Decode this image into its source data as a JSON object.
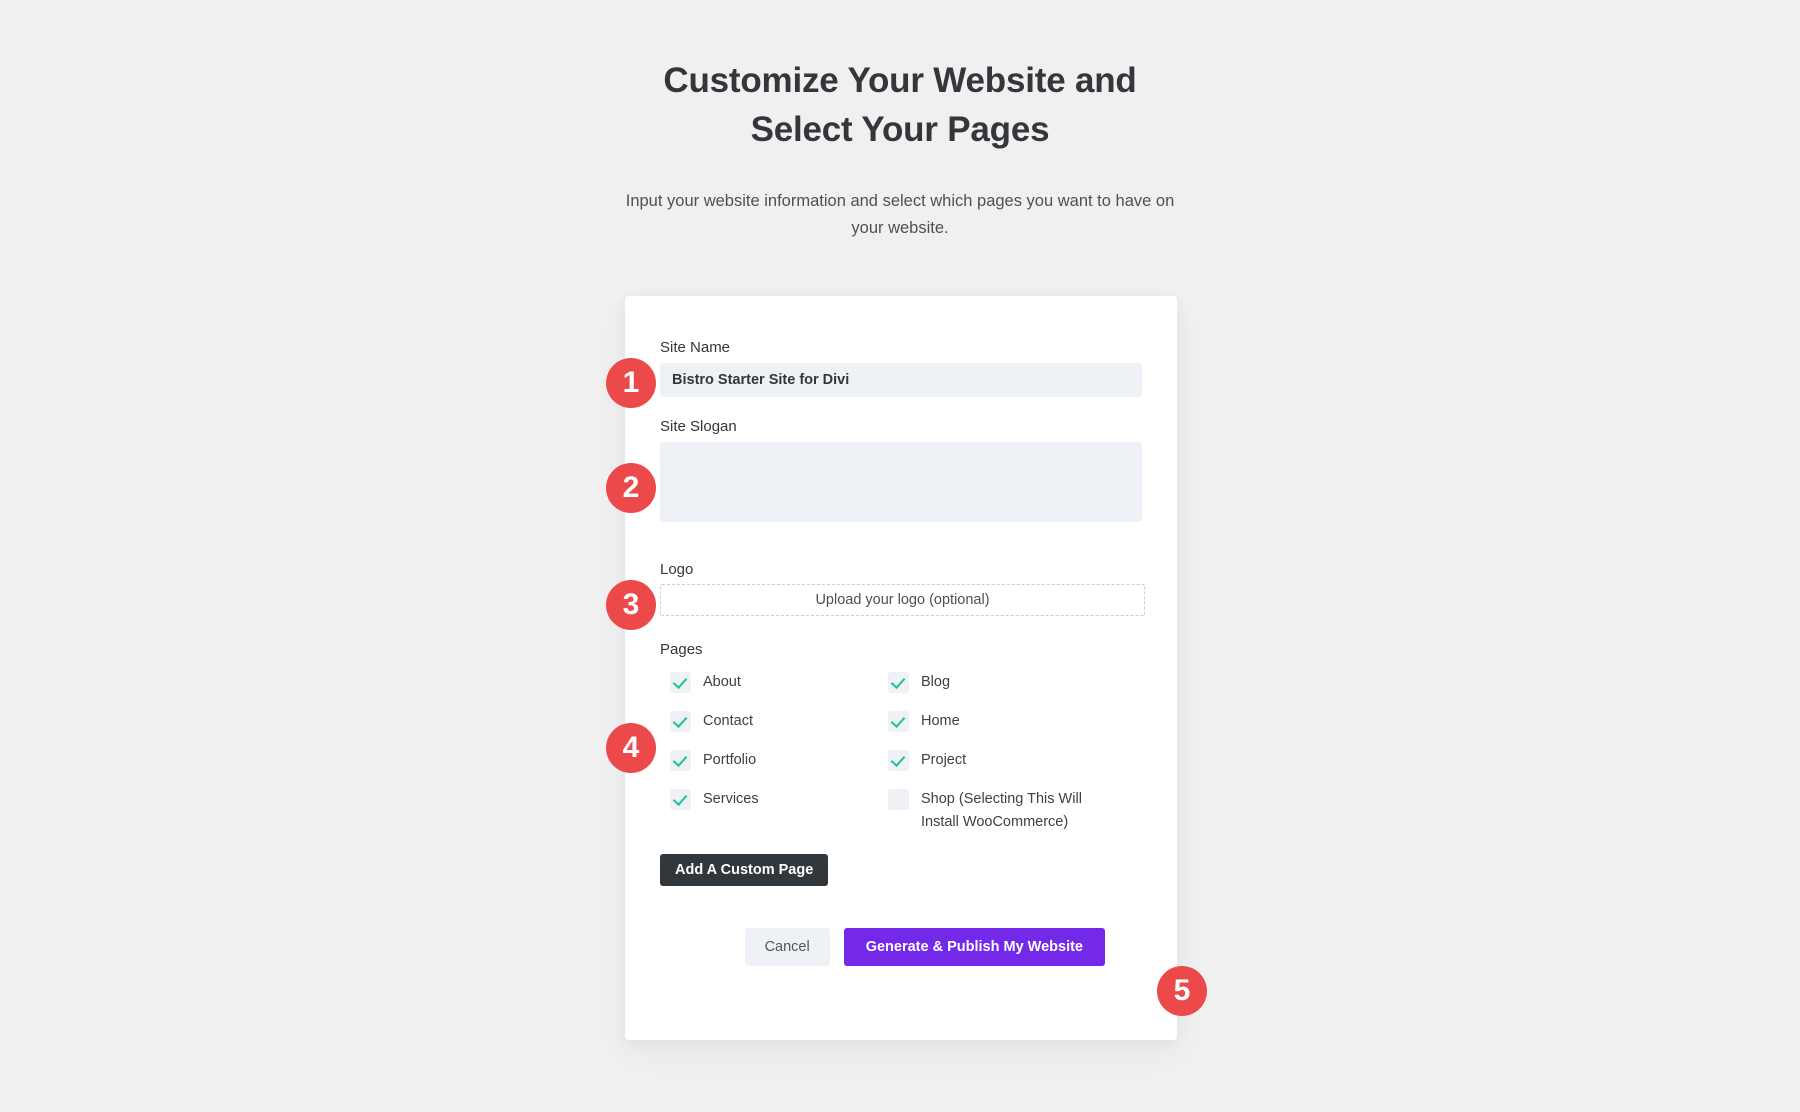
{
  "header": {
    "title": "Customize Your Website and Select Your Pages",
    "subtitle": "Input your website information and select which pages you want to have on your website."
  },
  "form": {
    "site_name": {
      "label": "Site Name",
      "value": "Bistro Starter Site for Divi",
      "placeholder": ""
    },
    "site_slogan": {
      "label": "Site Slogan",
      "value": "",
      "placeholder": ""
    },
    "logo": {
      "label": "Logo",
      "upload_text": "Upload your logo (optional)"
    },
    "pages": {
      "label": "Pages",
      "options": [
        {
          "label": "About",
          "checked": true
        },
        {
          "label": "Blog",
          "checked": true
        },
        {
          "label": "Contact",
          "checked": true
        },
        {
          "label": "Home",
          "checked": true
        },
        {
          "label": "Portfolio",
          "checked": true
        },
        {
          "label": "Project",
          "checked": true
        },
        {
          "label": "Services",
          "checked": true
        },
        {
          "label": "Shop (Selecting This Will Install WooCommerce)",
          "checked": false
        }
      ]
    },
    "add_custom_page_label": "Add A Custom Page",
    "cancel_label": "Cancel",
    "publish_label": "Generate & Publish My Website"
  },
  "annotations": {
    "badges": [
      "1",
      "2",
      "3",
      "4",
      "5"
    ],
    "color": "#ec4a4a"
  },
  "colors": {
    "page_background": "#f0f0f0",
    "card_background": "#ffffff",
    "input_background": "#eef2f7",
    "accent_purple": "#7429e8",
    "dark_button": "#32373c",
    "check_green": "#19c693",
    "badge_red": "#ec4a4a"
  }
}
